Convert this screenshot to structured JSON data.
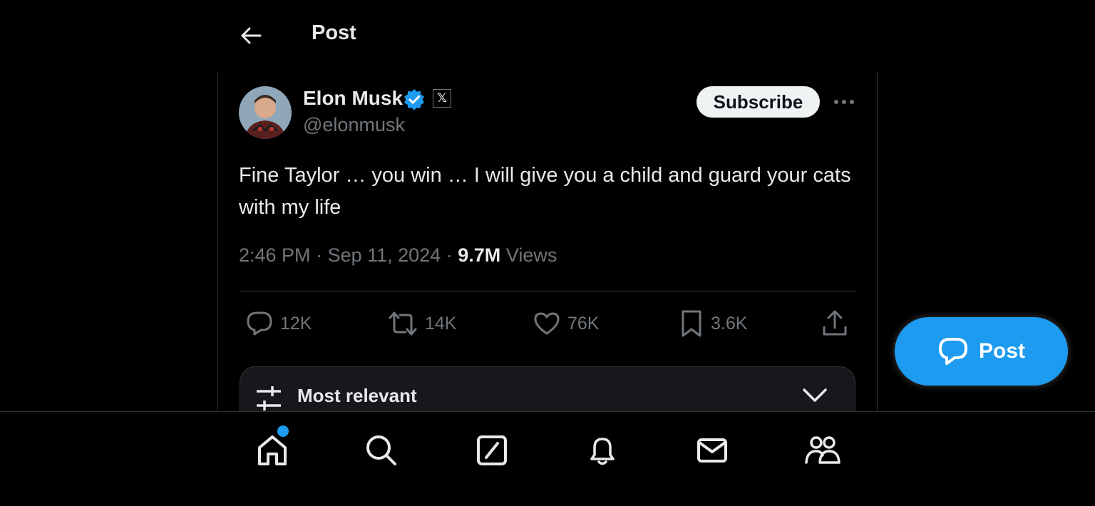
{
  "header": {
    "title": "Post"
  },
  "post": {
    "author": {
      "name": "Elon Musk",
      "handle": "@elonmusk",
      "affiliate_badge": "𝕏"
    },
    "subscribe_label": "Subscribe",
    "text": "Fine Taylor … you win … I will give you a child and guard your cats with my life",
    "time": "2:46 PM",
    "separator": "·",
    "date": "Sep 11, 2024",
    "views_count": "9.7M",
    "views_label": "Views",
    "stats": {
      "replies": "12K",
      "reposts": "14K",
      "likes": "76K",
      "bookmarks": "3.6K"
    }
  },
  "replies_sort": {
    "label": "Most relevant"
  },
  "fab": {
    "label": "Post"
  },
  "bottom_nav": {
    "items": [
      "home-icon",
      "search-icon",
      "grok-icon",
      "bell-icon",
      "mail-icon",
      "communities-icon"
    ]
  },
  "colors": {
    "background": "#000000",
    "text": "#e7e9ea",
    "secondary": "#71767b",
    "accent": "#1d9bf0",
    "border": "#2f3336"
  }
}
